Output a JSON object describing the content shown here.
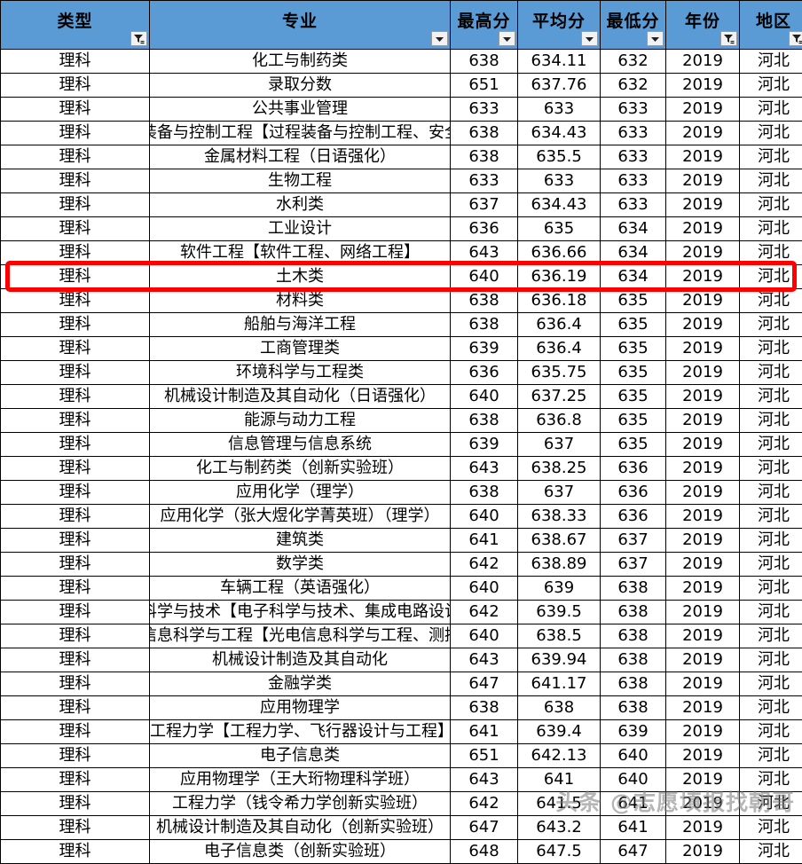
{
  "table": {
    "columns": [
      {
        "key": "type",
        "label": "类型",
        "control": "filter-icon"
      },
      {
        "key": "major",
        "label": "专业",
        "control": "dropdown-arrow"
      },
      {
        "key": "max",
        "label": "最高分",
        "control": "dropdown-arrow"
      },
      {
        "key": "avg",
        "label": "平均分",
        "control": "dropdown-arrow"
      },
      {
        "key": "min",
        "label": "最低分",
        "control": "dropdown-arrow"
      },
      {
        "key": "year",
        "label": "年份",
        "control": "filter-icon"
      },
      {
        "key": "region",
        "label": "地区",
        "control": "filter-icon"
      }
    ],
    "rows": [
      {
        "type": "理科",
        "major": "化工与制药类",
        "max": "638",
        "avg": "634.11",
        "min": "632",
        "year": "2019",
        "region": "河北",
        "wide": false,
        "highlighted": false
      },
      {
        "type": "理科",
        "major": "录取分数",
        "max": "651",
        "avg": "637.76",
        "min": "632",
        "year": "2019",
        "region": "河北",
        "wide": false,
        "highlighted": false
      },
      {
        "type": "理科",
        "major": "公共事业管理",
        "max": "633",
        "avg": "633",
        "min": "633",
        "year": "2019",
        "region": "河北",
        "wide": false,
        "highlighted": false
      },
      {
        "type": "理科",
        "major": "过程装备与控制工程【过程装备与控制工程、安全工程】",
        "max": "638",
        "avg": "634.43",
        "min": "633",
        "year": "2019",
        "region": "河北",
        "wide": true,
        "highlighted": false
      },
      {
        "type": "理科",
        "major": "金属材料工程（日语强化）",
        "max": "638",
        "avg": "635.5",
        "min": "633",
        "year": "2019",
        "region": "河北",
        "wide": false,
        "highlighted": false
      },
      {
        "type": "理科",
        "major": "生物工程",
        "max": "633",
        "avg": "633",
        "min": "633",
        "year": "2019",
        "region": "河北",
        "wide": false,
        "highlighted": false
      },
      {
        "type": "理科",
        "major": "水利类",
        "max": "637",
        "avg": "634.43",
        "min": "633",
        "year": "2019",
        "region": "河北",
        "wide": false,
        "highlighted": false
      },
      {
        "type": "理科",
        "major": "工业设计",
        "max": "636",
        "avg": "635",
        "min": "634",
        "year": "2019",
        "region": "河北",
        "wide": false,
        "highlighted": false
      },
      {
        "type": "理科",
        "major": "软件工程【软件工程、网络工程】",
        "max": "643",
        "avg": "636.66",
        "min": "634",
        "year": "2019",
        "region": "河北",
        "wide": false,
        "highlighted": false
      },
      {
        "type": "理科",
        "major": "土木类",
        "max": "640",
        "avg": "636.19",
        "min": "634",
        "year": "2019",
        "region": "河北",
        "wide": false,
        "highlighted": true
      },
      {
        "type": "理科",
        "major": "材料类",
        "max": "638",
        "avg": "636.18",
        "min": "635",
        "year": "2019",
        "region": "河北",
        "wide": false,
        "highlighted": false
      },
      {
        "type": "理科",
        "major": "船舶与海洋工程",
        "max": "638",
        "avg": "636.4",
        "min": "635",
        "year": "2019",
        "region": "河北",
        "wide": false,
        "highlighted": false
      },
      {
        "type": "理科",
        "major": "工商管理类",
        "max": "639",
        "avg": "636.4",
        "min": "635",
        "year": "2019",
        "region": "河北",
        "wide": false,
        "highlighted": false
      },
      {
        "type": "理科",
        "major": "环境科学与工程类",
        "max": "636",
        "avg": "635.75",
        "min": "635",
        "year": "2019",
        "region": "河北",
        "wide": false,
        "highlighted": false
      },
      {
        "type": "理科",
        "major": "机械设计制造及其自动化（日语强化）",
        "max": "640",
        "avg": "637.25",
        "min": "635",
        "year": "2019",
        "region": "河北",
        "wide": false,
        "highlighted": false
      },
      {
        "type": "理科",
        "major": "能源与动力工程",
        "max": "638",
        "avg": "636.8",
        "min": "635",
        "year": "2019",
        "region": "河北",
        "wide": false,
        "highlighted": false
      },
      {
        "type": "理科",
        "major": "信息管理与信息系统",
        "max": "639",
        "avg": "637",
        "min": "635",
        "year": "2019",
        "region": "河北",
        "wide": false,
        "highlighted": false
      },
      {
        "type": "理科",
        "major": "化工与制药类（创新实验班）",
        "max": "643",
        "avg": "638.25",
        "min": "636",
        "year": "2019",
        "region": "河北",
        "wide": false,
        "highlighted": false
      },
      {
        "type": "理科",
        "major": "应用化学（理学）",
        "max": "638",
        "avg": "637",
        "min": "636",
        "year": "2019",
        "region": "河北",
        "wide": false,
        "highlighted": false
      },
      {
        "type": "理科",
        "major": "应用化学（张大煜化学菁英班）（理学）",
        "max": "640",
        "avg": "638.33",
        "min": "636",
        "year": "2019",
        "region": "河北",
        "wide": false,
        "highlighted": false
      },
      {
        "type": "理科",
        "major": "建筑类",
        "max": "641",
        "avg": "638.67",
        "min": "637",
        "year": "2019",
        "region": "河北",
        "wide": false,
        "highlighted": false
      },
      {
        "type": "理科",
        "major": "数学类",
        "max": "642",
        "avg": "638.89",
        "min": "637",
        "year": "2019",
        "region": "河北",
        "wide": false,
        "highlighted": false
      },
      {
        "type": "理科",
        "major": "车辆工程（英语强化）",
        "max": "640",
        "avg": "639",
        "min": "638",
        "year": "2019",
        "region": "河北",
        "wide": false,
        "highlighted": false
      },
      {
        "type": "理科",
        "major": "电子科学与技术【电子科学与技术、集成电路设计与集成系统】",
        "max": "642",
        "avg": "639.5",
        "min": "638",
        "year": "2019",
        "region": "河北",
        "wide": true,
        "highlighted": false
      },
      {
        "type": "理科",
        "major": "光电信息科学与工程【光电信息科学与工程、测控技术与仪器】",
        "max": "640",
        "avg": "638.5",
        "min": "638",
        "year": "2019",
        "region": "河北",
        "wide": true,
        "highlighted": false
      },
      {
        "type": "理科",
        "major": "机械设计制造及其自动化",
        "max": "643",
        "avg": "639.94",
        "min": "638",
        "year": "2019",
        "region": "河北",
        "wide": false,
        "highlighted": false
      },
      {
        "type": "理科",
        "major": "金融学类",
        "max": "647",
        "avg": "641.17",
        "min": "638",
        "year": "2019",
        "region": "河北",
        "wide": false,
        "highlighted": false
      },
      {
        "type": "理科",
        "major": "应用物理学",
        "max": "638",
        "avg": "638",
        "min": "638",
        "year": "2019",
        "region": "河北",
        "wide": false,
        "highlighted": false
      },
      {
        "type": "理科",
        "major": "工程力学【工程力学、飞行器设计与工程】",
        "max": "641",
        "avg": "639.4",
        "min": "639",
        "year": "2019",
        "region": "河北",
        "wide": false,
        "highlighted": false
      },
      {
        "type": "理科",
        "major": "电子信息类",
        "max": "651",
        "avg": "642.13",
        "min": "640",
        "year": "2019",
        "region": "河北",
        "wide": false,
        "highlighted": false
      },
      {
        "type": "理科",
        "major": "应用物理学（王大珩物理科学班）",
        "max": "643",
        "avg": "641",
        "min": "640",
        "year": "2019",
        "region": "河北",
        "wide": false,
        "highlighted": false
      },
      {
        "type": "理科",
        "major": "工程力学（钱令希力学创新实验班）",
        "max": "642",
        "avg": "641.5",
        "min": "641",
        "year": "2019",
        "region": "河北",
        "wide": false,
        "highlighted": false
      },
      {
        "type": "理科",
        "major": "机械设计制造及其自动化（创新实验班）",
        "max": "647",
        "avg": "643.2",
        "min": "641",
        "year": "2019",
        "region": "河北",
        "wide": false,
        "highlighted": false
      },
      {
        "type": "理科",
        "major": "电子信息类（创新实验班）",
        "max": "648",
        "avg": "647.5",
        "min": "647",
        "year": "2019",
        "region": "河北",
        "wide": false,
        "highlighted": false
      }
    ]
  },
  "watermark": {
    "text": "头条 @志愿填报找朝哥"
  },
  "colors": {
    "header_fill": "#5B9BD5",
    "grid_line": "#000000",
    "highlight_border": "#FF0000"
  }
}
